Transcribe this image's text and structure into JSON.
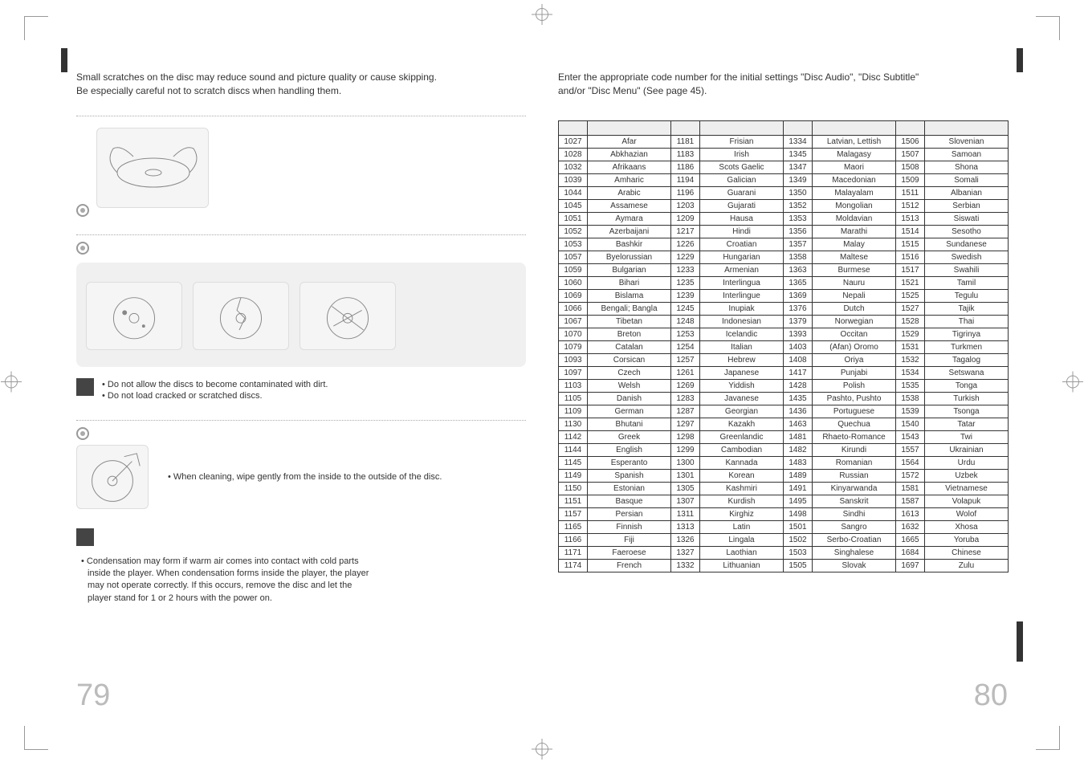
{
  "left": {
    "intro_line1": "Small scratches on the disc may reduce sound and picture quality or cause skipping.",
    "intro_line2": "Be especially careful not to scratch discs when handling them.",
    "note_bullet1": "• Do not allow the discs to become contaminated with dirt.",
    "note_bullet2": "• Do not load cracked or scratched discs.",
    "clean_tip": "• When cleaning, wipe gently from the inside to the outside of the disc.",
    "condense_lead": "• Condensation may form if warm air comes into contact with cold parts",
    "condense_l2": "inside the player. When condensation forms inside the player, the player",
    "condense_l3": "may not operate correctly. If this occurs, remove the disc and let the",
    "condense_l4": "player stand for 1 or 2 hours with the power on.",
    "page_no": "79"
  },
  "right": {
    "intro_line1": "Enter the appropriate code number for the initial settings \"Disc Audio\", \"Disc Subtitle\"",
    "intro_line2": "and/or \"Disc Menu\" (See page 45).",
    "page_no": "80",
    "table_headers": [
      "",
      "",
      "",
      "",
      "",
      "",
      "",
      ""
    ],
    "rows": [
      [
        "1027",
        "Afar",
        "1181",
        "Frisian",
        "1334",
        "Latvian, Lettish",
        "1506",
        "Slovenian"
      ],
      [
        "1028",
        "Abkhazian",
        "1183",
        "Irish",
        "1345",
        "Malagasy",
        "1507",
        "Samoan"
      ],
      [
        "1032",
        "Afrikaans",
        "1186",
        "Scots Gaelic",
        "1347",
        "Maori",
        "1508",
        "Shona"
      ],
      [
        "1039",
        "Amharic",
        "1194",
        "Galician",
        "1349",
        "Macedonian",
        "1509",
        "Somali"
      ],
      [
        "1044",
        "Arabic",
        "1196",
        "Guarani",
        "1350",
        "Malayalam",
        "1511",
        "Albanian"
      ],
      [
        "1045",
        "Assamese",
        "1203",
        "Gujarati",
        "1352",
        "Mongolian",
        "1512",
        "Serbian"
      ],
      [
        "1051",
        "Aymara",
        "1209",
        "Hausa",
        "1353",
        "Moldavian",
        "1513",
        "Siswati"
      ],
      [
        "1052",
        "Azerbaijani",
        "1217",
        "Hindi",
        "1356",
        "Marathi",
        "1514",
        "Sesotho"
      ],
      [
        "1053",
        "Bashkir",
        "1226",
        "Croatian",
        "1357",
        "Malay",
        "1515",
        "Sundanese"
      ],
      [
        "1057",
        "Byelorussian",
        "1229",
        "Hungarian",
        "1358",
        "Maltese",
        "1516",
        "Swedish"
      ],
      [
        "1059",
        "Bulgarian",
        "1233",
        "Armenian",
        "1363",
        "Burmese",
        "1517",
        "Swahili"
      ],
      [
        "1060",
        "Bihari",
        "1235",
        "Interlingua",
        "1365",
        "Nauru",
        "1521",
        "Tamil"
      ],
      [
        "1069",
        "Bislama",
        "1239",
        "Interlingue",
        "1369",
        "Nepali",
        "1525",
        "Tegulu"
      ],
      [
        "1066",
        "Bengali; Bangla",
        "1245",
        "Inupiak",
        "1376",
        "Dutch",
        "1527",
        "Tajik"
      ],
      [
        "1067",
        "Tibetan",
        "1248",
        "Indonesian",
        "1379",
        "Norwegian",
        "1528",
        "Thai"
      ],
      [
        "1070",
        "Breton",
        "1253",
        "Icelandic",
        "1393",
        "Occitan",
        "1529",
        "Tigrinya"
      ],
      [
        "1079",
        "Catalan",
        "1254",
        "Italian",
        "1403",
        "(Afan) Oromo",
        "1531",
        "Turkmen"
      ],
      [
        "1093",
        "Corsican",
        "1257",
        "Hebrew",
        "1408",
        "Oriya",
        "1532",
        "Tagalog"
      ],
      [
        "1097",
        "Czech",
        "1261",
        "Japanese",
        "1417",
        "Punjabi",
        "1534",
        "Setswana"
      ],
      [
        "1103",
        "Welsh",
        "1269",
        "Yiddish",
        "1428",
        "Polish",
        "1535",
        "Tonga"
      ],
      [
        "1105",
        "Danish",
        "1283",
        "Javanese",
        "1435",
        "Pashto, Pushto",
        "1538",
        "Turkish"
      ],
      [
        "1109",
        "German",
        "1287",
        "Georgian",
        "1436",
        "Portuguese",
        "1539",
        "Tsonga"
      ],
      [
        "1130",
        "Bhutani",
        "1297",
        "Kazakh",
        "1463",
        "Quechua",
        "1540",
        "Tatar"
      ],
      [
        "1142",
        "Greek",
        "1298",
        "Greenlandic",
        "1481",
        "Rhaeto-Romance",
        "1543",
        "Twi"
      ],
      [
        "1144",
        "English",
        "1299",
        "Cambodian",
        "1482",
        "Kirundi",
        "1557",
        "Ukrainian"
      ],
      [
        "1145",
        "Esperanto",
        "1300",
        "Kannada",
        "1483",
        "Romanian",
        "1564",
        "Urdu"
      ],
      [
        "1149",
        "Spanish",
        "1301",
        "Korean",
        "1489",
        "Russian",
        "1572",
        "Uzbek"
      ],
      [
        "1150",
        "Estonian",
        "1305",
        "Kashmiri",
        "1491",
        "Kinyarwanda",
        "1581",
        "Vietnamese"
      ],
      [
        "1151",
        "Basque",
        "1307",
        "Kurdish",
        "1495",
        "Sanskrit",
        "1587",
        "Volapuk"
      ],
      [
        "1157",
        "Persian",
        "1311",
        "Kirghiz",
        "1498",
        "Sindhi",
        "1613",
        "Wolof"
      ],
      [
        "1165",
        "Finnish",
        "1313",
        "Latin",
        "1501",
        "Sangro",
        "1632",
        "Xhosa"
      ],
      [
        "1166",
        "Fiji",
        "1326",
        "Lingala",
        "1502",
        "Serbo-Croatian",
        "1665",
        "Yoruba"
      ],
      [
        "1171",
        "Faeroese",
        "1327",
        "Laothian",
        "1503",
        "Singhalese",
        "1684",
        "Chinese"
      ],
      [
        "1174",
        "French",
        "1332",
        "Lithuanian",
        "1505",
        "Slovak",
        "1697",
        "Zulu"
      ]
    ]
  }
}
